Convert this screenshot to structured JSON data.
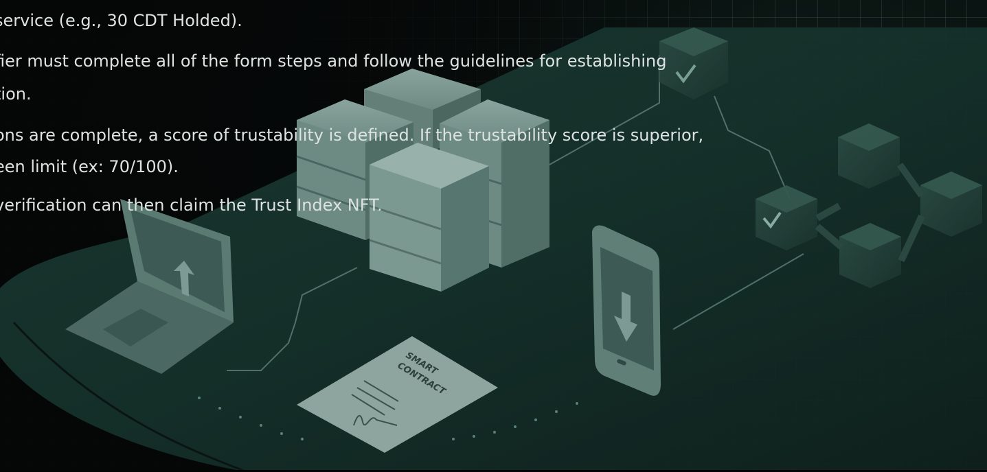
{
  "paragraphs": [
    {
      "line1": "service (e.g., 30 CDT Holded)."
    },
    {
      "line1": "fier must complete all of the form steps and follow the guidelines for establishing",
      "line2": "tion."
    },
    {
      "line1": "ons are complete, a score of trustability is defined. If the trustability score is superior,",
      "line2": "een limit (ex: 70/100)."
    },
    {
      "line1": "verification can then claim the Trust Index NFT."
    }
  ],
  "illustration": {
    "document_label": "SMART CONTRACT",
    "icons": [
      "laptop-upload-icon",
      "server-stack-icon",
      "smart-contract-document-icon",
      "phone-download-icon",
      "blockchain-blocks-icon",
      "checkmark-icon"
    ]
  },
  "colors": {
    "background": "#060808",
    "platform": "#16322b",
    "text": "#dde3e1",
    "device": "#5a7a72"
  }
}
